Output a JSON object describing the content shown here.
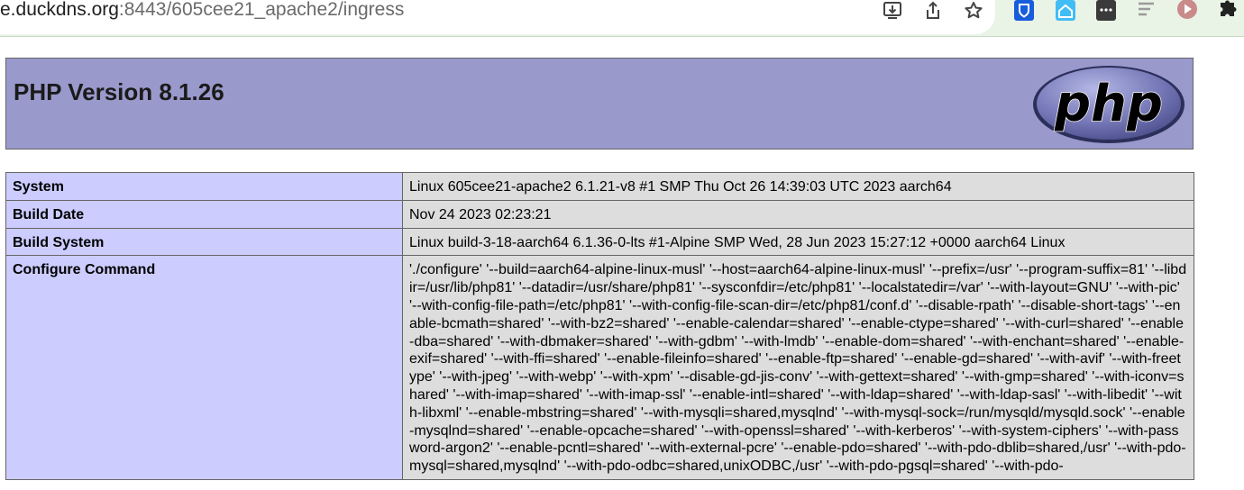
{
  "browser": {
    "url_host": "e.duckdns.org",
    "url_rest": ":8443/605cee21_apache2/ingress",
    "icons": [
      "download-icon",
      "share-icon",
      "bookmark-star-icon",
      "bitwarden-icon",
      "home-assistant-icon",
      "extension-dots-icon",
      "reader-icon",
      "media-play-icon",
      "puzzle-extensions-icon"
    ],
    "colors": {
      "frame": "#e9f3e6",
      "bitwarden": "#175ddc",
      "home_assistant": "#41bdf5"
    }
  },
  "php": {
    "title": "PHP Version 8.1.26",
    "logo_text": "php",
    "colors": {
      "header": "#9999cc",
      "key_cell": "#ccccff",
      "value_cell": "#dddddd"
    },
    "rows": [
      {
        "key": "System",
        "value": "Linux 605cee21-apache2 6.1.21-v8 #1 SMP Thu Oct 26 14:39:03 UTC 2023 aarch64"
      },
      {
        "key": "Build Date",
        "value": "Nov 24 2023 02:23:21"
      },
      {
        "key": "Build System",
        "value": "Linux build-3-18-aarch64 6.1.36-0-lts #1-Alpine SMP Wed, 28 Jun 2023 15:27:12 +0000 aarch64 Linux"
      },
      {
        "key": "Configure Command",
        "value": "'./configure' '--build=aarch64-alpine-linux-musl' '--host=aarch64-alpine-linux-musl' '--prefix=/usr' '--program-suffix=81' '--libdir=/usr/lib/php81' '--datadir=/usr/share/php81' '--sysconfdir=/etc/php81' '--localstatedir=/var' '--with-layout=GNU' '--with-pic' '--with-config-file-path=/etc/php81' '--with-config-file-scan-dir=/etc/php81/conf.d' '--disable-rpath' '--disable-short-tags' '--enable-bcmath=shared' '--with-bz2=shared' '--enable-calendar=shared' '--enable-ctype=shared' '--with-curl=shared' '--enable-dba=shared' '--with-dbmaker=shared' '--with-gdbm' '--with-lmdb' '--enable-dom=shared' '--with-enchant=shared' '--enable-exif=shared' '--with-ffi=shared' '--enable-fileinfo=shared' '--enable-ftp=shared' '--enable-gd=shared' '--with-avif' '--with-freetype' '--with-jpeg' '--with-webp' '--with-xpm' '--disable-gd-jis-conv' '--with-gettext=shared' '--with-gmp=shared' '--with-iconv=shared' '--with-imap=shared' '--with-imap-ssl' '--enable-intl=shared' '--with-ldap=shared' '--with-ldap-sasl' '--with-libedit' '--with-libxml' '--enable-mbstring=shared' '--with-mysqli=shared,mysqlnd' '--with-mysql-sock=/run/mysqld/mysqld.sock' '--enable-mysqlnd=shared' '--enable-opcache=shared' '--with-openssl=shared' '--with-kerberos' '--with-system-ciphers' '--with-password-argon2' '--enable-pcntl=shared' '--with-external-pcre' '--enable-pdo=shared' '--with-pdo-dblib=shared,/usr' '--with-pdo-mysql=shared,mysqlnd' '--with-pdo-odbc=shared,unixODBC,/usr' '--with-pdo-pgsql=shared' '--with-pdo-"
      }
    ]
  }
}
